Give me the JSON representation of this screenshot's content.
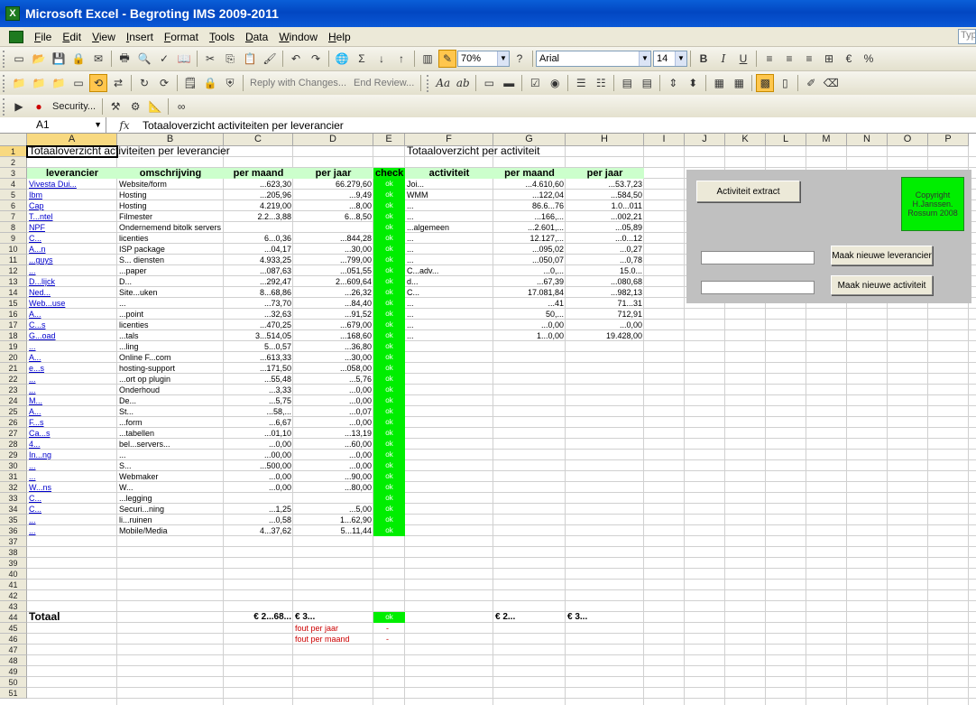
{
  "window": {
    "title": "Microsoft Excel - Begroting IMS 2009-2011"
  },
  "menu": {
    "items": [
      {
        "u": "F",
        "rest": "ile"
      },
      {
        "u": "E",
        "rest": "dit"
      },
      {
        "u": "V",
        "rest": "iew"
      },
      {
        "u": "I",
        "rest": "nsert"
      },
      {
        "u": "F",
        "rest": "ormat",
        "pre": ""
      },
      {
        "u": "T",
        "rest": "ools"
      },
      {
        "u": "D",
        "rest": "ata"
      },
      {
        "u": "W",
        "rest": "indow"
      },
      {
        "u": "H",
        "rest": "elp"
      }
    ],
    "ask_placeholder": "Typ"
  },
  "toolbar": {
    "zoom": "70%",
    "font": "Arial",
    "size": "14",
    "reply": "Reply with Changes...",
    "end_review": "End Review...",
    "security": "Security..."
  },
  "formula": {
    "name_box": "A1",
    "fx": "fx",
    "content": "Totaaloverzicht activiteiten per leverancier"
  },
  "columns": [
    "A",
    "B",
    "C",
    "D",
    "E",
    "F",
    "G",
    "H",
    "I",
    "J",
    "K",
    "L",
    "M",
    "N",
    "O",
    "P"
  ],
  "rows": [
    "1",
    "2",
    "3",
    "4",
    "5",
    "6",
    "7",
    "8",
    "9",
    "10",
    "11",
    "12",
    "13",
    "14",
    "15",
    "16",
    "17",
    "18",
    "19",
    "20",
    "21",
    "22",
    "23",
    "24",
    "25",
    "26",
    "27",
    "28",
    "29",
    "30",
    "31",
    "32",
    "33",
    "34",
    "35",
    "36",
    "37",
    "38",
    "39",
    "40",
    "41",
    "42",
    "43",
    "44",
    "45",
    "46",
    "47",
    "48",
    "49",
    "50",
    "51"
  ],
  "sheet": {
    "title_left": "Totaaloverzicht activiteiten per leverancier",
    "title_right": "Totaaloverzicht per activiteit",
    "headers_left": [
      "leverancier",
      "omschrijving",
      "per maand",
      "per jaar",
      "check"
    ],
    "headers_right": [
      "activiteit",
      "per maand",
      "per jaar"
    ],
    "left_rows": [
      [
        "Vivesta Dui...",
        "Website/form",
        "...623,30",
        "66.279,60",
        "ok"
      ],
      [
        "Ibm",
        "Hosting",
        "...205,96",
        "...9,49",
        "ok"
      ],
      [
        "Cap",
        "Hosting",
        "4.219,00",
        "...8,00",
        "ok"
      ],
      [
        "T...ntel",
        "Filmester",
        "2.2...3,88",
        "6...8,50",
        "ok"
      ],
      [
        "NPF",
        "Ondernemend bitolk servers",
        "",
        "",
        "ok"
      ],
      [
        "C...",
        "licenties",
        "6...0,36",
        "...844,28",
        "ok"
      ],
      [
        "A...n",
        "ISP package",
        "...04,17",
        "...30,00",
        "ok"
      ],
      [
        "...guys",
        "S... diensten",
        "4.933,25",
        "...799,00",
        "ok"
      ],
      [
        "...",
        "...paper",
        "...087,63",
        "...051,55",
        "ok"
      ],
      [
        "D...lijck",
        "D...",
        "...292,47",
        "2...609,64",
        "ok"
      ],
      [
        "Ned...",
        "Site...uken",
        "8...68,86",
        "...26,32",
        "ok"
      ],
      [
        "Web...use",
        "...",
        "...73,70",
        "...84,40",
        "ok"
      ],
      [
        "A...",
        "...point",
        "...32,63",
        "...91,52",
        "ok"
      ],
      [
        "C...s",
        "licenties",
        "...470,25",
        "...679,00",
        "ok"
      ],
      [
        "G...oad",
        "...tals",
        "3...514,05",
        "...168,60",
        "ok"
      ],
      [
        "...",
        "...ling",
        "5...0,57",
        "...36,80",
        "ok"
      ],
      [
        "A...",
        "Online F...com",
        "...613,33",
        "...30,00",
        "ok"
      ],
      [
        "e...s",
        "hosting-support",
        "...171,50",
        "...058,00",
        "ok"
      ],
      [
        "...",
        "...ort op plugin",
        "...55,48",
        "...5,76",
        "ok"
      ],
      [
        "...",
        "Onderhoud",
        "...3,33",
        "...0,00",
        "ok"
      ],
      [
        "M...",
        "De...",
        "...5,75",
        "...0,00",
        "ok"
      ],
      [
        "A...",
        "St...",
        "...58,...",
        "...0,07",
        "ok"
      ],
      [
        "F...s",
        "...form",
        "...6,67",
        "...0,00",
        "ok"
      ],
      [
        "Ca...s",
        "...tabellen",
        "...01,10",
        "...13,19",
        "ok"
      ],
      [
        "4...",
        "bel...servers...",
        "...0,00",
        "...60,00",
        "ok"
      ],
      [
        "In...ng",
        "...",
        "...00,00",
        "...0,00",
        "ok"
      ],
      [
        "...",
        "S...",
        "...500,00",
        "...0,00",
        "ok"
      ],
      [
        "...",
        "Webmaker",
        "...0,00",
        "...90,00",
        "ok"
      ],
      [
        "W...ns",
        "W...",
        "...0,00",
        "...80,00",
        "ok"
      ],
      [
        "C...",
        "...legging",
        "",
        "",
        "ok"
      ],
      [
        "C...",
        "Securi...ning",
        "...1,25",
        "...5,00",
        "ok"
      ],
      [
        "...",
        "li...ruinen",
        "...0,58",
        "1...62,90",
        "ok"
      ],
      [
        "...",
        "Mobile/Media",
        "4...37,62",
        "5...11,44",
        "ok"
      ]
    ],
    "right_rows": [
      [
        "Joi...",
        "...4.610,60",
        "...53.7,23"
      ],
      [
        "WMM",
        "...122,04",
        "...584,50"
      ],
      [
        "...",
        "86.6...76",
        "1.0...011"
      ],
      [
        "...",
        "...166,...",
        "...002,21"
      ],
      [
        "...algemeen",
        "...2.601,...",
        "...05,89"
      ],
      [
        "...",
        "12.127,...",
        "...0...12"
      ],
      [
        "...",
        "...095,02",
        "...0,27"
      ],
      [
        "...",
        "...050,07",
        "...0,78"
      ],
      [
        "C...adv...",
        "...0,...",
        "15.0..."
      ],
      [
        "d...",
        "...67,39",
        "...080,68"
      ],
      [
        "C...",
        "17.081,84",
        "...982,13"
      ],
      [
        "...",
        "...41",
        "71...31"
      ],
      [
        "...",
        "50,...",
        "712,91"
      ],
      [
        "...",
        "...0,00",
        "...0,00"
      ],
      [
        "...",
        "1...0,00",
        "19.428,00"
      ]
    ],
    "total_label": "Totaal",
    "total_month": "€ 2...68...",
    "total_year": "€ 3...",
    "total_check": "ok",
    "total_month_right": "€ 2...",
    "total_year_right": "€ 3...",
    "fout_jaar": "fout per jaar",
    "fout_maand": "fout per maand",
    "fout_dash": "-"
  },
  "buttons": {
    "extract": "Activiteit extract",
    "new_supplier": "Maak nieuwe leverancier",
    "new_activity": "Maak nieuwe activiteit"
  },
  "copyright": [
    "Copyright",
    "H.Janssen.",
    "Rossum 2008"
  ],
  "colors": {
    "green": "#00ee00",
    "header_green": "#ccffcc",
    "title_blue": "#0247c2"
  }
}
